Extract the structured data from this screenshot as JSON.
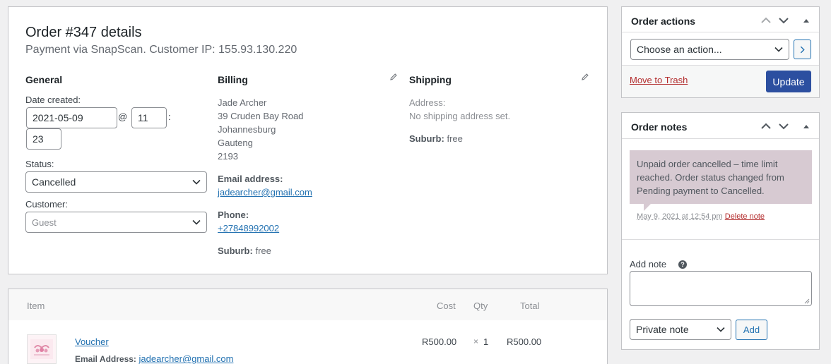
{
  "order": {
    "title": "Order #347 details",
    "subtitle": "Payment via SnapScan. Customer IP: 155.93.130.220"
  },
  "general": {
    "heading": "General",
    "date_created_label": "Date created:",
    "date_value": "2021-05-09",
    "at_symbol": "@",
    "hour_value": "11",
    "colon": ":",
    "minute_value": "23",
    "status_label": "Status:",
    "status_value": "Cancelled",
    "customer_label": "Customer:",
    "customer_value": "Guest"
  },
  "billing": {
    "heading": "Billing",
    "name": "Jade Archer",
    "address1": "39 Cruden Bay Road",
    "city": "Johannesburg",
    "state": "Gauteng",
    "postcode": "2193",
    "email_label": "Email address:",
    "email": "jadearcher@gmail.com",
    "phone_label": "Phone:",
    "phone": "+27848992002",
    "suburb_label": "Suburb:",
    "suburb_value": "free"
  },
  "shipping": {
    "heading": "Shipping",
    "address_label": "Address:",
    "address_value": "No shipping address set.",
    "suburb_label": "Suburb:",
    "suburb_value": "free"
  },
  "items": {
    "col_item": "Item",
    "col_cost": "Cost",
    "col_qty": "Qty",
    "col_total": "Total",
    "rows": [
      {
        "name": "Voucher",
        "cost": "R500.00",
        "qty_symbol": "×",
        "qty": "1",
        "total": "R500.00",
        "meta_label": "Email Address:",
        "meta_value": "jadearcher@gmail.com"
      }
    ]
  },
  "order_actions": {
    "title": "Order actions",
    "select_value": "Choose an action...",
    "trash_label": "Move to Trash",
    "update_label": "Update"
  },
  "order_notes": {
    "title": "Order notes",
    "note_text": "Unpaid order cancelled – time limit reached. Order status changed from Pending payment to Cancelled.",
    "note_date": "May 9, 2021 at 12:54 pm",
    "delete_label": "Delete note",
    "add_note_label": "Add note",
    "help_symbol": "?",
    "note_type_value": "Private note",
    "add_button_label": "Add"
  },
  "colors": {
    "accent": "#2271b1",
    "update_button": "#2c4fa0",
    "note_bg": "#d7cad2",
    "trash": "#b32d2e"
  }
}
